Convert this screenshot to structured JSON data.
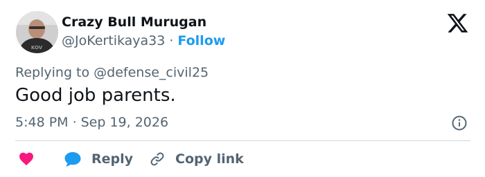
{
  "author": {
    "display_name": "Crazy Bull Murugan",
    "handle": "@JoKertikaya33",
    "separator": "·",
    "follow_label": "Follow",
    "avatar_shirt_text": "KOV"
  },
  "reply_context": {
    "prefix": "Replying to ",
    "mention": "@defense_civil25"
  },
  "tweet": {
    "text": "Good job parents.",
    "time": "5:48 PM",
    "separator": "·",
    "date": "Sep 19, 2026"
  },
  "actions": {
    "reply_label": "Reply",
    "copy_link_label": "Copy link"
  },
  "colors": {
    "accent": "#1d9bf0",
    "like": "#f91880",
    "text_primary": "#0f1419",
    "text_secondary": "#536471",
    "divider": "#cfd9de"
  },
  "icons": {
    "brand": "x-logo-icon",
    "info": "info-icon",
    "like": "heart-icon",
    "reply": "speech-bubble-icon",
    "copy": "link-icon"
  }
}
